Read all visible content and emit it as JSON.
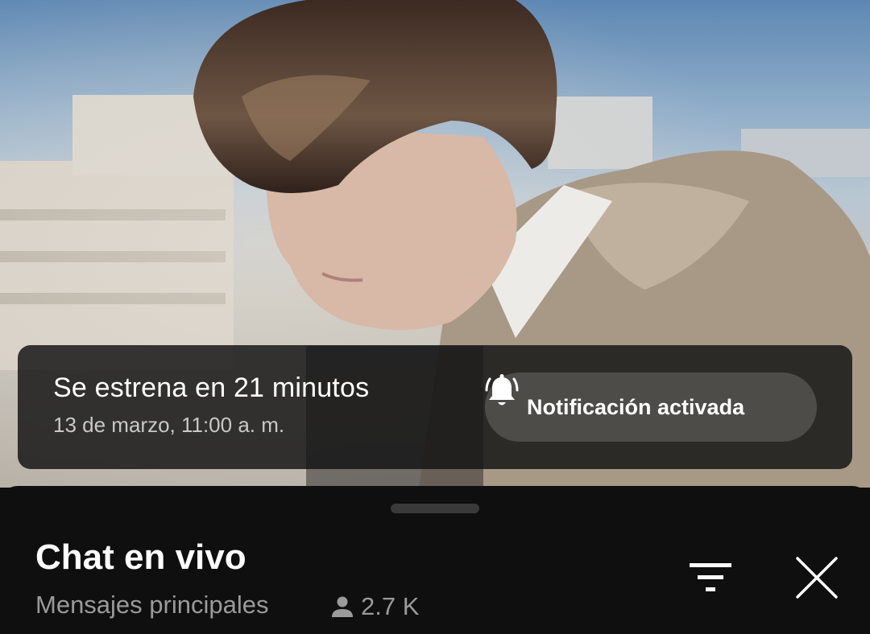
{
  "premiere": {
    "title": "Se estrena en 21 minutos",
    "date": "13 de marzo, 11:00 a. m.",
    "notify_label": "Notificación activada",
    "notify_icon": "bell-ringing-icon"
  },
  "chat": {
    "title": "Chat en vivo",
    "subtitle": "Mensajes principales",
    "viewers": "2.7 K",
    "viewer_icon": "person-icon",
    "filter_icon": "filter-icon",
    "close_icon": "close-icon"
  },
  "colors": {
    "sheet_bg": "#0f0f0f",
    "text_primary": "#ffffff",
    "text_secondary": "#9a9a9a"
  }
}
